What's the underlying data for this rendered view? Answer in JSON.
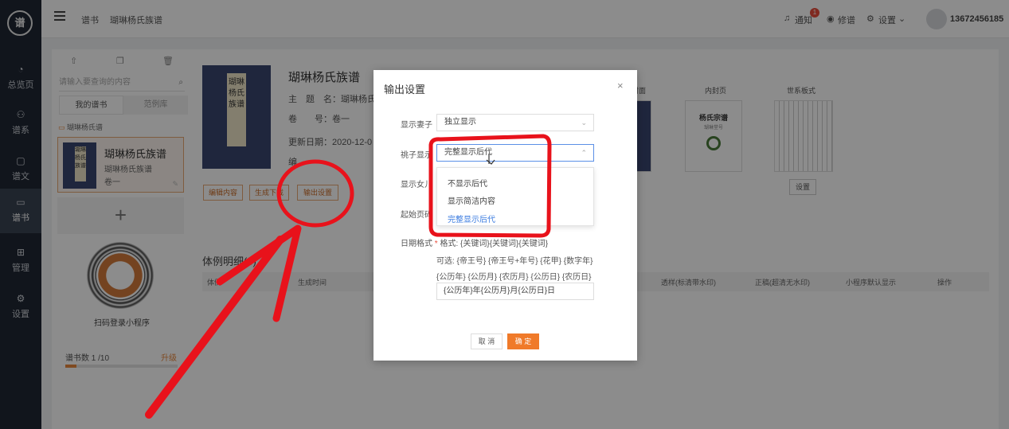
{
  "colors": {
    "accent": "#f07a29",
    "annotation": "#e8121b",
    "rail": "#1f2733",
    "link_selected": "#3d7de0"
  },
  "rail": {
    "logo_icon": "logo-seal",
    "items": [
      {
        "label": "总览页",
        "icon": "pie-chart-icon"
      },
      {
        "label": "谱系",
        "icon": "tree-icon"
      },
      {
        "label": "谱文",
        "icon": "document-icon"
      },
      {
        "label": "谱书",
        "icon": "book-icon"
      },
      {
        "label": "管理",
        "icon": "grid-icon"
      },
      {
        "label": "设置",
        "icon": "gear-icon"
      }
    ]
  },
  "topbar": {
    "breadcrumb": [
      "谱书",
      "瑚琳杨氏族谱"
    ],
    "notice_label": "通知",
    "notice_count": "1",
    "revise_label": "修谱",
    "settings_label": "设置",
    "phone": "13672456185"
  },
  "left_panel": {
    "search_placeholder": "请输入要查询的内容",
    "tabs": [
      "我的谱书",
      "范例库"
    ],
    "folder": "瑚琳杨氏谱",
    "card": {
      "cover_text": "瑚琳杨氏族谱",
      "title": "瑚琳杨氏族谱",
      "subtitle": "瑚琳杨氏族谱",
      "volume": "卷一"
    },
    "qr_caption": "扫码登录小程序",
    "quota_label": "谱书数",
    "quota_value": "1 /10",
    "upgrade_label": "升级",
    "quota_fraction": 0.1
  },
  "main": {
    "cover_text": "瑚琳杨氏族谱",
    "title": "瑚琳杨氏族谱",
    "topic_row": "主　题　名：瑚琳杨氏族",
    "volume_row": "卷　　号：卷一",
    "updated_row": "更新日期：2020-12-0",
    "editor_row": "编",
    "buttons": [
      "编辑内容",
      "生成下载",
      "输出设置"
    ],
    "thumb_captions": [
      "封面",
      "内封页",
      "世系板式"
    ],
    "inner_title": "杨氏宗谱",
    "inner_sub": "瑚琳堂号",
    "thumb_button": "设置",
    "section_title": "体例明细(0)",
    "table_headers": [
      "体例",
      "生成时间",
      "透样(标清带水印)",
      "正稿(超清无水印)",
      "小程序默认显示",
      "操作"
    ]
  },
  "dialog": {
    "title": "输出设置",
    "fields": {
      "spouse_label": "显示妻子",
      "spouse_value": "独立显示",
      "step_label": "祧子显示",
      "step_value": "完整显示后代",
      "daughter_label": "显示女儿",
      "start_page_label": "起始页码"
    },
    "dropdown_options": [
      "不显示后代",
      "显示简洁内容",
      "完整显示后代"
    ],
    "dropdown_selected": 2,
    "date_label": "日期格式",
    "date_format_line": "格式: {关键词}{关键词}{关键词}",
    "date_options_1": "可选: {帝王号} {帝王号+年号} {花甲} {数字年}",
    "date_options_2": "{公历年} {公历月} {农历月} {公历日} {农历日}",
    "date_value": "{公历年}年{公历月}月{公历日}日",
    "cancel": "取 消",
    "ok": "确 定"
  }
}
